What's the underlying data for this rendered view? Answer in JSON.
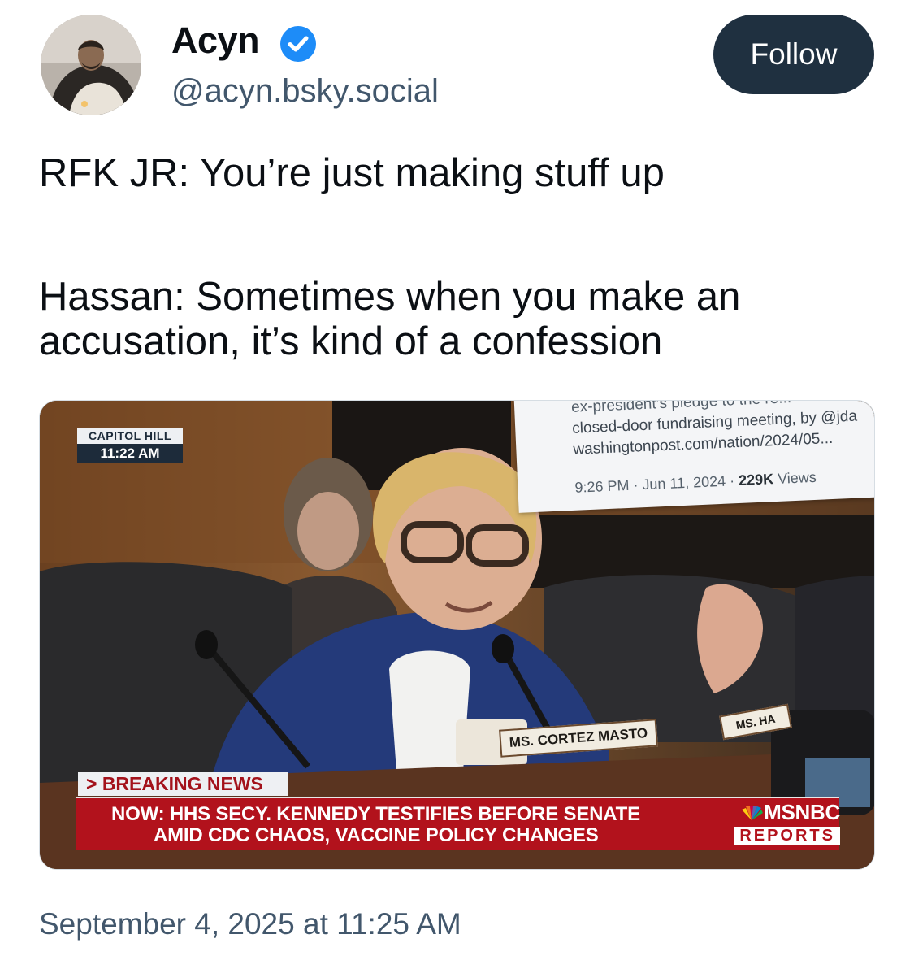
{
  "author": {
    "display_name": "Acyn",
    "handle": "@acyn.bsky.social",
    "verified": true,
    "avatar_icon": "profile-photo"
  },
  "follow_button": {
    "label": "Follow"
  },
  "post": {
    "line1": "RFK JR: You’re just making stuff up",
    "line2": "Hassan: Sometimes when you make an accusation, it’s kind of a confession"
  },
  "media": {
    "location_top": "CAPITOL HILL",
    "location_time": "11:22 AM",
    "screen_text": {
      "line1": "ex-president’s pledge to the re...",
      "line2": "closed-door fundraising meeting, by @jda",
      "line3": "washingtonpost.com/nation/2024/05...",
      "meta": "9:26 PM · Jun 11, 2024 · ",
      "views": "229K",
      "views_suffix": " Views"
    },
    "nameplate_1": "MS. CORTEZ MASTO",
    "nameplate_2": "MS. HA",
    "breaking_tag": "> BREAKING NEWS",
    "breaking_line1": "NOW: HHS SECY. KENNEDY TESTIFIES BEFORE SENATE",
    "breaking_line2": "AMID CDC CHAOS, VACCINE POLICY CHANGES",
    "network": "MSNBC",
    "network_sub": "REPORTS"
  },
  "timestamp": "September 4, 2025 at 11:25 AM",
  "colors": {
    "follow_bg": "#1f3040",
    "verified_blue": "#1d8cf8",
    "handle_gray": "#42576c",
    "breaking_red": "#b2121c"
  }
}
